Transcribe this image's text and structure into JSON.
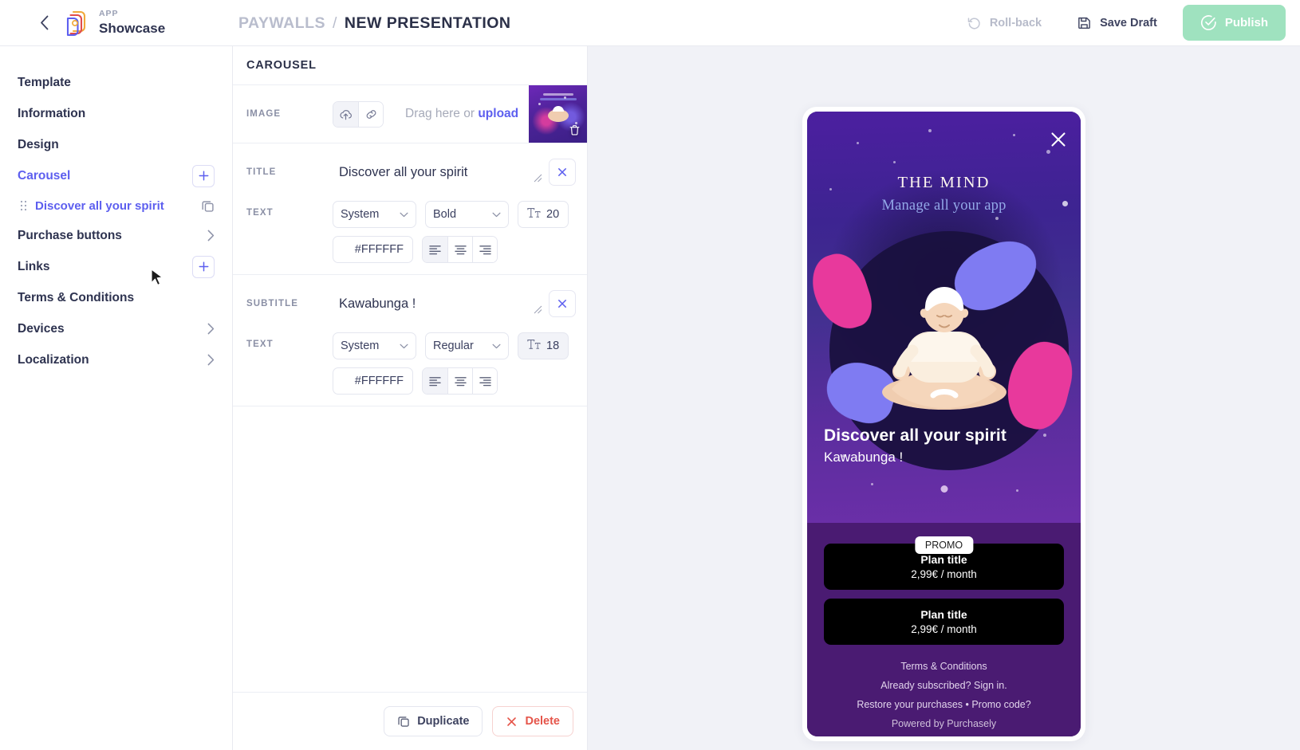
{
  "header": {
    "back_icon": "chevron-left-icon",
    "logo_icon": "purchasely-logo-icon",
    "app_kicker": "APP",
    "app_name": "Showcase",
    "breadcrumb_parent": "PAYWALLS",
    "breadcrumb_sep": "/",
    "breadcrumb_current": "NEW PRESENTATION",
    "rollback_label": "Roll-back",
    "save_draft_label": "Save Draft",
    "publish_label": "Publish",
    "publish_color": "#9fe2bf"
  },
  "sidebar": {
    "items": [
      {
        "label": "Template",
        "action": "none"
      },
      {
        "label": "Information",
        "action": "none"
      },
      {
        "label": "Design",
        "action": "none"
      },
      {
        "label": "Carousel",
        "action": "plus",
        "active": true
      },
      {
        "label": "Purchase buttons",
        "action": "chevron"
      },
      {
        "label": "Links",
        "action": "plus"
      },
      {
        "label": "Terms & Conditions",
        "action": "none"
      },
      {
        "label": "Devices",
        "action": "chevron"
      },
      {
        "label": "Localization",
        "action": "chevron"
      }
    ],
    "child_item": {
      "label": "Discover all your spirit",
      "drag_icon": "drag-handle-icon",
      "copy_icon": "duplicate-icon"
    },
    "accent_color": "#5d5fef"
  },
  "editor": {
    "panel_title": "CAROUSEL",
    "image": {
      "key": "IMAGE",
      "upload_icon": "cloud-upload-icon",
      "link_icon": "link-icon",
      "drag_text_prefix": "Drag here or ",
      "drag_text_link": "upload",
      "delete_icon": "trash-icon"
    },
    "title_field": {
      "key": "TITLE",
      "value": "Discover all your spirit",
      "clear_icon": "close-icon",
      "resize_icon": "resize-grip-icon",
      "text_key": "TEXT",
      "font_family": "System",
      "font_weight": "Bold",
      "font_size": "20",
      "size_icon": "font-size-icon",
      "color_hex": "#FFFFFF",
      "align": "left"
    },
    "subtitle_field": {
      "key": "SUBTITLE",
      "value": "Kawabunga !",
      "clear_icon": "close-icon",
      "resize_icon": "resize-grip-icon",
      "text_key": "TEXT",
      "font_family": "System",
      "font_weight": "Regular",
      "font_size": "18",
      "size_icon": "font-size-icon",
      "color_hex": "#FFFFFF",
      "align": "left"
    },
    "footer": {
      "duplicate_label": "Duplicate",
      "duplicate_icon": "duplicate-icon",
      "delete_label": "Delete",
      "delete_icon": "close-icon"
    }
  },
  "preview": {
    "close_icon": "close-icon",
    "brand_title": "THE MIND",
    "brand_subtitle": "Manage all your app",
    "slide_title": "Discover all your spirit",
    "slide_subtitle": "Kawabunga !",
    "promo_badge": "PROMO",
    "plans": [
      {
        "title": "Plan title",
        "price": "2,99€ / month",
        "promo": true
      },
      {
        "title": "Plan title",
        "price": "2,99€ / month",
        "promo": false
      }
    ],
    "footer_links": [
      "Terms & Conditions",
      "Already subscribed? Sign in.",
      "Restore your purchases • Promo code?",
      "Powered by Purchasely"
    ]
  }
}
